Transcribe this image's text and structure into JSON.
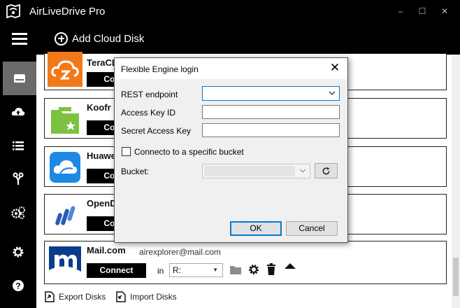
{
  "app": {
    "title": "AirLiveDrive Pro"
  },
  "window": {
    "minimize": "–",
    "maximize": "☐",
    "close": "✕"
  },
  "header": {
    "add_disk_label": "Add Cloud Disk"
  },
  "sidebar": {
    "items": [
      {
        "icon": "drive-icon",
        "active": true
      },
      {
        "icon": "cloud-upload-icon",
        "active": false
      },
      {
        "icon": "list-icon",
        "active": false
      },
      {
        "icon": "scissors-icon",
        "active": false
      },
      {
        "icon": "gears-icon",
        "active": false
      },
      {
        "icon": "settings-icon",
        "active": false
      },
      {
        "icon": "help-icon",
        "active": false
      }
    ]
  },
  "disks": [
    {
      "name": "TeraCLOUD",
      "name_visible": "TeraCL",
      "connect_label": "Conne",
      "logo_color": "#f07a1a"
    },
    {
      "name": "Koofr",
      "name_visible": "Koofr",
      "connect_label": "Conne",
      "logo_color": "#7cc242"
    },
    {
      "name": "Huawei",
      "name_visible": "Huawe",
      "connect_label": "Conne",
      "logo_color": "#1e88e5"
    },
    {
      "name": "OpenDrive",
      "name_visible": "OpenD",
      "connect_label": "Conne",
      "logo_color": "#2a5db0"
    }
  ],
  "mail_disk": {
    "name": "Mail.com",
    "email": "airexplorer@mail.com",
    "connect_label": "Connect",
    "in_label": "in",
    "drive_letter": "R:",
    "logo_color": "#0b3c8c"
  },
  "footer": {
    "export_label": "Export Disks",
    "import_label": "Import Disks"
  },
  "dialog": {
    "title": "Flexible Engine login",
    "rest_endpoint_label": "REST endpoint",
    "rest_endpoint_value": "",
    "access_key_label": "Access Key ID",
    "access_key_value": "",
    "secret_key_label": "Secret Access Key",
    "secret_key_value": "",
    "bucket_checkbox_label": "Connecto to a specific bucket",
    "bucket_checkbox_checked": false,
    "bucket_label": "Bucket:",
    "bucket_value": "",
    "ok_label": "OK",
    "cancel_label": "Cancel"
  },
  "colors": {
    "accent": "#0078d7",
    "sidebar_active": "#6b6b6b",
    "background": "#000000"
  }
}
